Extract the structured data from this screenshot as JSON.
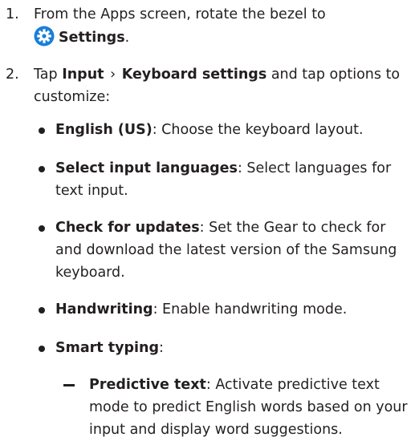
{
  "steps": [
    {
      "number": "1.",
      "text_before": "From the Apps screen, rotate the bezel to",
      "icon": "settings-gear-icon",
      "bold": "Settings",
      "text_after": "."
    },
    {
      "number": "2.",
      "text_before": "Tap ",
      "bold_1": "Input",
      "separator": "›",
      "bold_2": "Keyboard settings",
      "text_after": " and tap options to customize:"
    }
  ],
  "bullets": [
    {
      "term": "English (US)",
      "description": ": Choose the keyboard layout."
    },
    {
      "term": "Select input languages",
      "description": ": Select languages for text input."
    },
    {
      "term": "Check for updates",
      "description": ": Set the Gear to check for and download the latest version of the Samsung keyboard."
    },
    {
      "term": "Handwriting",
      "description": ": Enable handwriting mode."
    },
    {
      "term": "Smart typing",
      "description": ":"
    }
  ],
  "sub_items": [
    {
      "term": "Predictive text",
      "description": ": Activate predictive text mode to predict English words based on your input and display word suggestions."
    }
  ],
  "colors": {
    "text": "#231f20",
    "icon": "#1a7fd8"
  }
}
